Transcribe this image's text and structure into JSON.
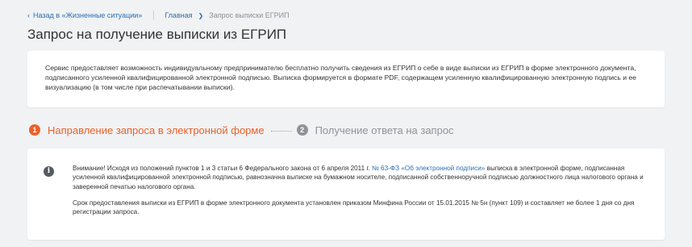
{
  "nav": {
    "back_label": "Назад в «Жизненные ситуации»",
    "breadcrumbs": [
      {
        "label": "Главная"
      },
      {
        "label": "Запрос выписки ЕГРИП"
      }
    ]
  },
  "page": {
    "title": "Запрос на получение выписки из ЕГРИП"
  },
  "description": {
    "text": "Сервис предоставляет возможность индивидуальному предпринимателю бесплатно получить сведения из ЕГРИП о себе в виде выписки из ЕГРИП в форме электронного документа, подписанного усиленной квалифицированной электронной подписью. Выписка формируется в формате PDF, содержащем усиленную квалифицированную электронную подпись и ее визуализацию (в том числе при распечатывании выписки)."
  },
  "steps": [
    {
      "number": "1",
      "label": "Направление запроса в электронной форме",
      "state": "active"
    },
    {
      "number": "2",
      "label": "Получение ответа на запрос",
      "state": "inactive"
    }
  ],
  "notice": {
    "icon": "info-icon",
    "para1_before": "Внимание! Исходя из положений пунктов 1 и 3 статьи 6 Федерального закона от 6 апреля 2011 г. ",
    "para1_link": "№ 63-ФЗ «Об электронной подписи»",
    "para1_after": " выписка в электронной форме, подписанная усиленной квалифицированной электронной подписью, равнозначна выписке на бумажном носителе, подписанной собственноручной подписью должностного лица налогового органа и заверенной печатью налогового органа.",
    "para2": "Срок предоставления выписки из ЕГРИП в форме электронного документа установлен приказом Минфина России от 15.01.2015 № 5н (пункт 109) и составляет не более 1 дня со дня регистрации запроса."
  },
  "colors": {
    "accent": "#e8622a",
    "link": "#2a6fb6",
    "inactive": "#8e9399",
    "background": "#f1f2f4"
  }
}
